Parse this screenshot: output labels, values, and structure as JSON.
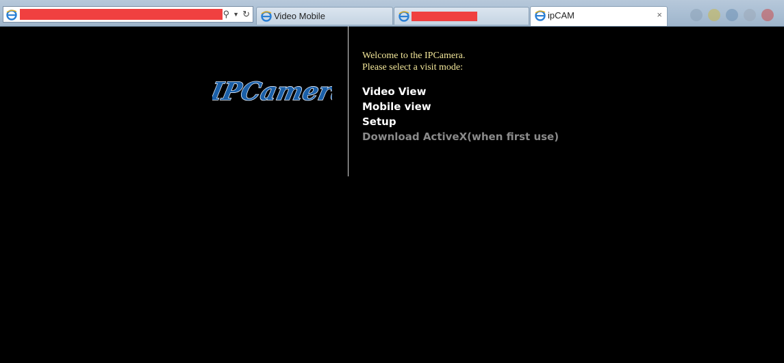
{
  "browser": {
    "address_bar": {
      "value": ""
    },
    "tabs": [
      {
        "label": "Video Mobile",
        "redacted": false
      },
      {
        "label": "",
        "redacted": true
      },
      {
        "label": "ipCAM",
        "active": true,
        "close_icon": "×"
      }
    ]
  },
  "page": {
    "logo_text": "IPCamera",
    "welcome_line1": "Welcome to the IPCamera.",
    "welcome_line2": "Please select a visit mode:",
    "menu": [
      {
        "label": "Video View"
      },
      {
        "label": "Mobile view"
      },
      {
        "label": "Setup"
      },
      {
        "label": "Download ActiveX(when first use)"
      }
    ]
  },
  "colors": {
    "background": "#000000",
    "welcome_text": "#f3e79a",
    "menu_text": "#ffffff",
    "menu_disabled_text": "#8a8a8a",
    "logo_fill": "#1a5fa8",
    "redaction": "#f04040"
  }
}
